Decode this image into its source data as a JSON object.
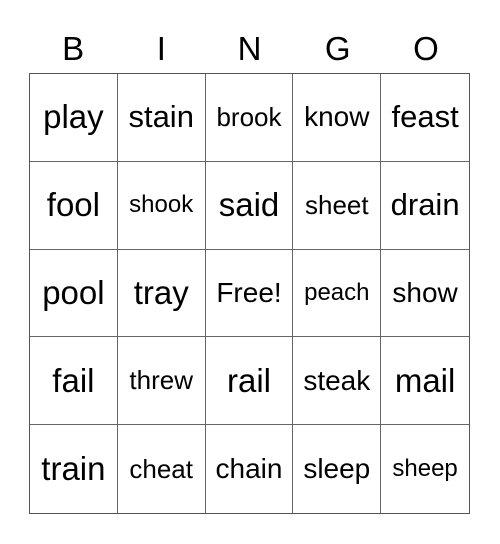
{
  "header": [
    "B",
    "I",
    "N",
    "G",
    "O"
  ],
  "cells": [
    [
      "play",
      "stain",
      "brook",
      "know",
      "feast"
    ],
    [
      "fool",
      "shook",
      "said",
      "sheet",
      "drain"
    ],
    [
      "pool",
      "tray",
      "Free!",
      "peach",
      "show"
    ],
    [
      "fail",
      "threw",
      "rail",
      "steak",
      "mail"
    ],
    [
      "train",
      "cheat",
      "chain",
      "sleep",
      "sheep"
    ]
  ]
}
